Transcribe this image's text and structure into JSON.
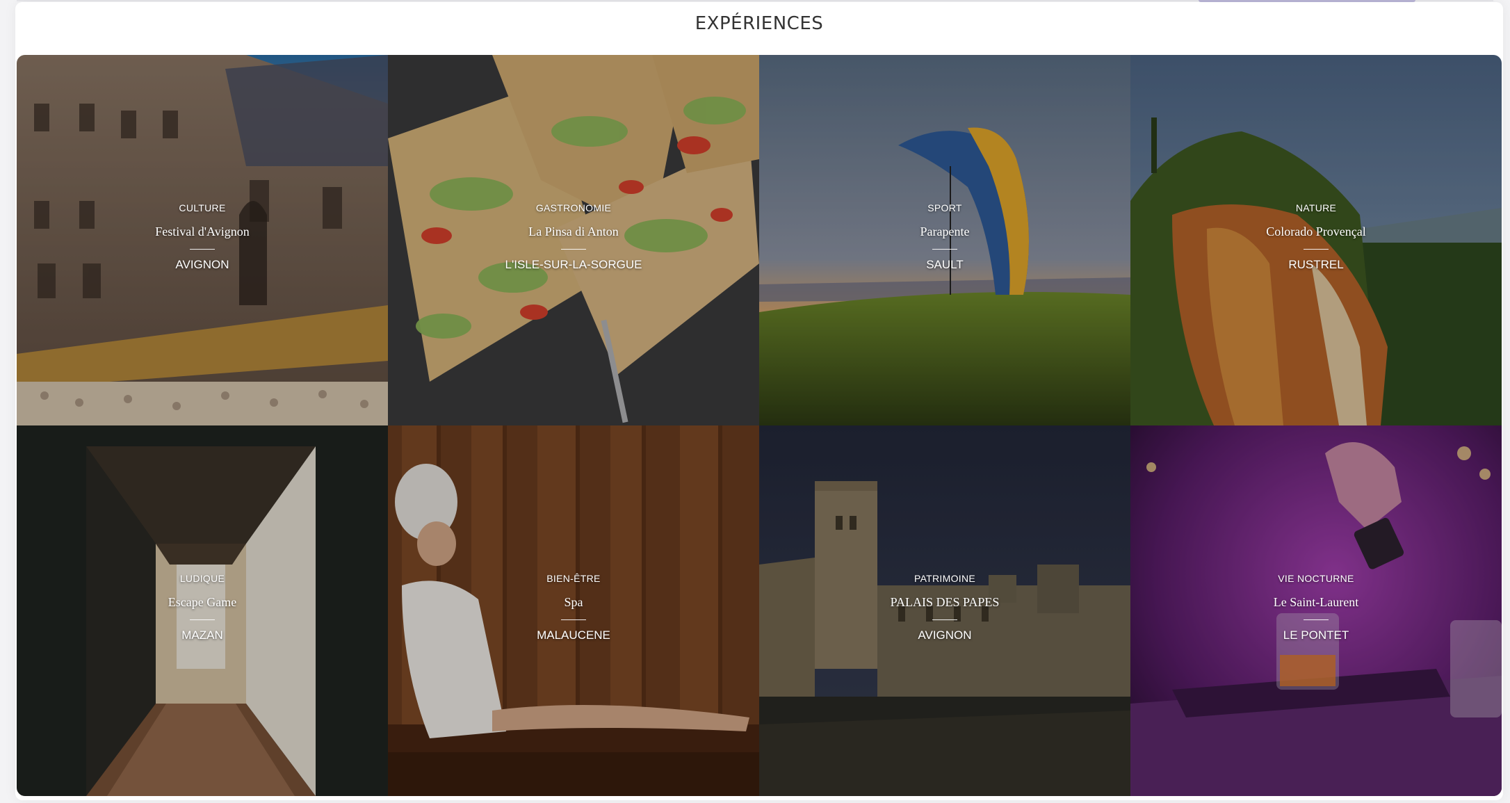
{
  "section_title": "EXPÉRIENCES",
  "experiences": [
    {
      "category": "CULTURE",
      "name": "Festival d'Avignon",
      "place": "AVIGNON",
      "image": "theatre-courtyard"
    },
    {
      "category": "GASTRONOMIE",
      "name": "La Pinsa di Anton",
      "place": "L'ISLE-SUR-LA-SORGUE",
      "image": "pinsa-slices"
    },
    {
      "category": "SPORT",
      "name": "Parapente",
      "place": "SAULT",
      "image": "paraglider-sunset"
    },
    {
      "category": "NATURE",
      "name": "Colorado Provençal",
      "place": "RUSTREL",
      "image": "ochre-cliffs"
    },
    {
      "category": "LUDIQUE",
      "name": "Escape Game",
      "place": "MAZAN",
      "image": "corridor"
    },
    {
      "category": "BIEN-ÊTRE",
      "name": "Spa",
      "place": "MALAUCENE",
      "image": "sauna"
    },
    {
      "category": "PATRIMOINE",
      "name": "PALAIS DES PAPES",
      "place": "AVIGNON",
      "image": "palace-night"
    },
    {
      "category": "VIE NOCTURNE",
      "name": "Le Saint-Laurent",
      "place": "LE PONTET",
      "image": "cocktail-bar"
    }
  ]
}
